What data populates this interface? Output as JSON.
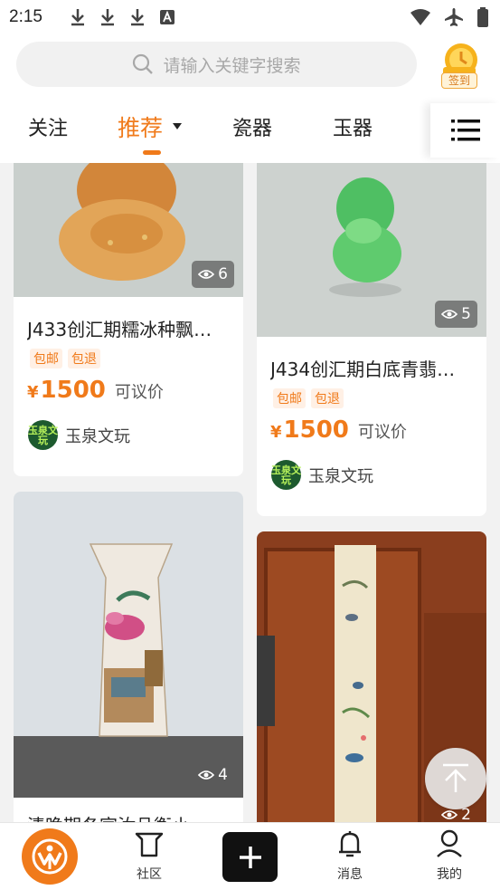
{
  "status_bar": {
    "time": "2:15"
  },
  "search": {
    "placeholder": "请输入关键字搜索"
  },
  "signin": {
    "label": "签到"
  },
  "tabs": [
    {
      "label": "关注",
      "active": false
    },
    {
      "label": "推荐",
      "active": true
    },
    {
      "label": "瓷器",
      "active": false
    },
    {
      "label": "玉器",
      "active": false
    }
  ],
  "cards": [
    {
      "title": "J433创汇期糯冰种飘…",
      "views": "6",
      "tags": [
        "包邮",
        "包退"
      ],
      "currency": "¥",
      "price": "1500",
      "negotiable": "可议价",
      "shop": "玉泉文玩",
      "shop_avatar_text": "玉泉文玩"
    },
    {
      "title": "J434创汇期白底青翡…",
      "views": "5",
      "tags": [
        "包邮",
        "包退"
      ],
      "currency": "¥",
      "price": "1500",
      "negotiable": "可议价",
      "shop": "玉泉文玩",
      "shop_avatar_text": "玉泉文玩"
    },
    {
      "title": "清晚期冬官汝品衡小",
      "views": "4"
    },
    {
      "views": "2"
    }
  ],
  "bottom_nav": {
    "community": "社区",
    "messages": "消息",
    "mine": "我的"
  },
  "colors": {
    "accent": "#f07a1a",
    "jade_green": "#5fc86a",
    "dark": "#111111"
  }
}
